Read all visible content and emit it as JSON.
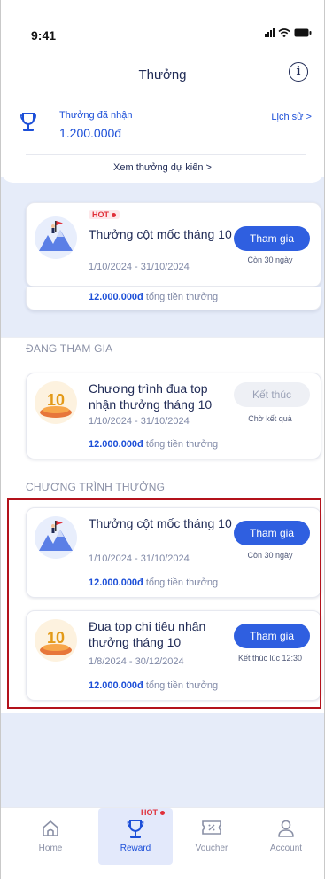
{
  "status_bar": {
    "time": "9:41"
  },
  "header": {
    "title": "Thưởng",
    "info_icon": "info-icon"
  },
  "summary": {
    "label": "Thưởng đã nhận",
    "amount": "1.200.000đ",
    "history_link": "Lịch sử >",
    "expected_link": "Xem thưởng dự kiến >",
    "trophy_icon": "trophy-icon"
  },
  "featured": {
    "hot_label": "HOT",
    "name": "Thưởng cột mốc tháng 10",
    "dates": "1/10/2024 - 31/10/2024",
    "prize_amount": "12.000.000đ",
    "prize_suffix": " tổng tiền thưởng",
    "button": "Tham gia",
    "note": "Còn 30 ngày"
  },
  "joining": {
    "section_title": "ĐANG THAM GIA",
    "card": {
      "name": "Chương trình đua top nhận thưởng tháng 10",
      "dates": "1/10/2024 - 31/10/2024",
      "prize_amount": "12.000.000đ",
      "prize_suffix": " tổng tiền thưởng",
      "button": "Kết thúc",
      "note": "Chờ kết quả"
    }
  },
  "programs": {
    "section_title": "CHƯƠNG TRÌNH THƯỞNG",
    "cards": [
      {
        "name": "Thưởng cột mốc tháng 10",
        "dates": "1/10/2024 - 31/10/2024",
        "prize_amount": "12.000.000đ",
        "prize_suffix": " tổng tiền thưởng",
        "button": "Tham gia",
        "note": "Còn 30 ngày"
      },
      {
        "name": "Đua top chi tiêu nhận thưởng tháng 10",
        "dates": "1/8/2024 - 30/12/2024",
        "prize_amount": "12.000.000đ",
        "prize_suffix": " tổng tiền thưởng",
        "button": "Tham gia",
        "note": "Kết thúc lúc 12:30"
      }
    ]
  },
  "tabs": [
    {
      "label": "Home",
      "icon": "home-icon",
      "active": false
    },
    {
      "label": "Reward",
      "icon": "trophy-icon",
      "active": true,
      "badge": "HOT"
    },
    {
      "label": "Voucher",
      "icon": "voucher-icon",
      "active": false
    },
    {
      "label": "Account",
      "icon": "account-icon",
      "active": false
    }
  ],
  "colors": {
    "accent": "#2f5fe0",
    "link": "#1c4fd8",
    "hot": "#e0303a",
    "highlight_border": "#b3121b",
    "blue_bg": "#e6ecf9"
  }
}
